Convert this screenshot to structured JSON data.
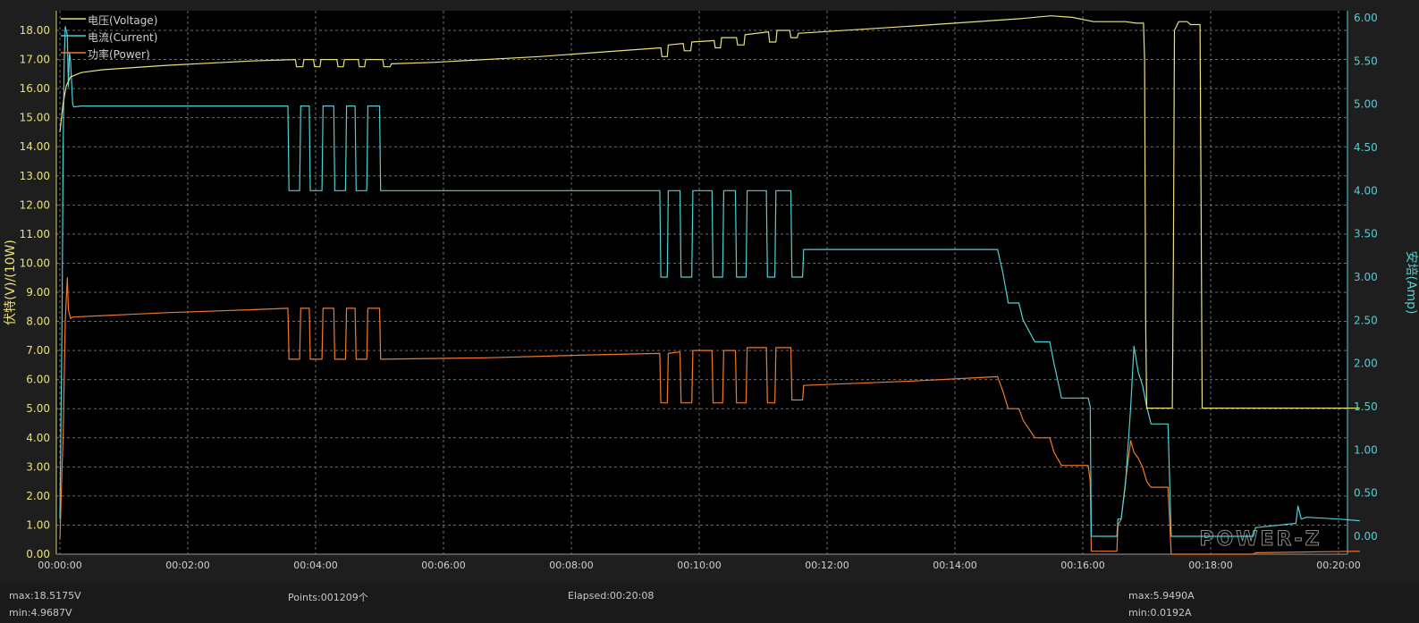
{
  "chart_data": {
    "type": "line",
    "xlabel": "",
    "y_left_label": "伏特(V)/(10W)",
    "y_right_label": "安培(Amp)",
    "x_range_seconds": [
      0,
      1220
    ],
    "x_ticks": [
      "00:00:00",
      "00:02:00",
      "00:04:00",
      "00:06:00",
      "00:08:00",
      "00:10:00",
      "00:12:00",
      "00:14:00",
      "00:16:00",
      "00:18:00",
      "00:20:00"
    ],
    "y_left_range": [
      0,
      18.5
    ],
    "y_left_ticks": [
      "0.00",
      "1.00",
      "2.00",
      "3.00",
      "4.00",
      "5.00",
      "6.00",
      "7.00",
      "8.00",
      "9.00",
      "10.00",
      "11.00",
      "12.00",
      "13.00",
      "14.00",
      "15.00",
      "16.00",
      "17.00",
      "18.00"
    ],
    "y_right_range": [
      -0.1,
      6.1
    ],
    "y_right_ticks": [
      "0.00",
      "0.50",
      "1.00",
      "1.50",
      "2.00",
      "2.50",
      "3.00",
      "3.50",
      "4.00",
      "4.50",
      "5.00",
      "5.50",
      "6.00"
    ],
    "grid": true,
    "legend_position": "top-left",
    "watermark": "POWER-Z",
    "series": [
      {
        "name": "电压(Voltage)",
        "color": "#e8e27a",
        "axis": "left",
        "points": [
          [
            0,
            14.5
          ],
          [
            3,
            15.5
          ],
          [
            6,
            16.1
          ],
          [
            10,
            16.4
          ],
          [
            20,
            16.55
          ],
          [
            40,
            16.65
          ],
          [
            100,
            16.8
          ],
          [
            180,
            16.95
          ],
          [
            221,
            17.0
          ],
          [
            222,
            16.75
          ],
          [
            228,
            16.75
          ],
          [
            229,
            17.0
          ],
          [
            238,
            17.0
          ],
          [
            239,
            16.75
          ],
          [
            244,
            16.75
          ],
          [
            245,
            17.0
          ],
          [
            260,
            17.0
          ],
          [
            261,
            16.75
          ],
          [
            266,
            16.75
          ],
          [
            267,
            17.0
          ],
          [
            280,
            17.0
          ],
          [
            281,
            16.75
          ],
          [
            286,
            16.75
          ],
          [
            287,
            17.0
          ],
          [
            303,
            17.0
          ],
          [
            304,
            16.75
          ],
          [
            310,
            16.75
          ],
          [
            311,
            16.85
          ],
          [
            350,
            16.9
          ],
          [
            450,
            17.1
          ],
          [
            564,
            17.4
          ],
          [
            565,
            17.1
          ],
          [
            570,
            17.1
          ],
          [
            571,
            17.5
          ],
          [
            585,
            17.55
          ],
          [
            586,
            17.3
          ],
          [
            592,
            17.3
          ],
          [
            593,
            17.6
          ],
          [
            614,
            17.65
          ],
          [
            615,
            17.4
          ],
          [
            620,
            17.4
          ],
          [
            621,
            17.75
          ],
          [
            635,
            17.75
          ],
          [
            636,
            17.5
          ],
          [
            642,
            17.5
          ],
          [
            643,
            17.85
          ],
          [
            665,
            17.95
          ],
          [
            666,
            17.6
          ],
          [
            672,
            17.6
          ],
          [
            673,
            18.0
          ],
          [
            685,
            18.0
          ],
          [
            686,
            17.75
          ],
          [
            692,
            17.75
          ],
          [
            693,
            17.9
          ],
          [
            800,
            18.15
          ],
          [
            900,
            18.4
          ],
          [
            930,
            18.5
          ],
          [
            950,
            18.45
          ],
          [
            970,
            18.3
          ],
          [
            1000,
            18.3
          ],
          [
            1010,
            18.25
          ],
          [
            1017,
            18.25
          ],
          [
            1018,
            17.0
          ],
          [
            1019,
            8.0
          ],
          [
            1020,
            5.02
          ],
          [
            1044,
            5.02
          ],
          [
            1045,
            10.0
          ],
          [
            1046,
            18.0
          ],
          [
            1050,
            18.3
          ],
          [
            1058,
            18.3
          ],
          [
            1061,
            18.2
          ],
          [
            1070,
            18.2
          ],
          [
            1071,
            12.0
          ],
          [
            1072,
            5.02
          ],
          [
            1220,
            5.02
          ]
        ]
      },
      {
        "name": "电流(Current)",
        "color": "#4ed0d4",
        "axis": "right",
        "points": [
          [
            0,
            0.2
          ],
          [
            2,
            2.5
          ],
          [
            3,
            4.5
          ],
          [
            4,
            5.5
          ],
          [
            5,
            5.9
          ],
          [
            7,
            5.8
          ],
          [
            8,
            5.2
          ],
          [
            9,
            5.6
          ],
          [
            10,
            5.5
          ],
          [
            12,
            5.0
          ],
          [
            13,
            4.97
          ],
          [
            20,
            4.98
          ],
          [
            100,
            4.98
          ],
          [
            180,
            4.98
          ],
          [
            214,
            4.98
          ],
          [
            215,
            4.0
          ],
          [
            225,
            4.0
          ],
          [
            226,
            4.98
          ],
          [
            234,
            4.98
          ],
          [
            235,
            4.0
          ],
          [
            246,
            4.0
          ],
          [
            247,
            4.98
          ],
          [
            257,
            4.98
          ],
          [
            258,
            4.0
          ],
          [
            268,
            4.0
          ],
          [
            269,
            4.98
          ],
          [
            277,
            4.98
          ],
          [
            278,
            4.0
          ],
          [
            288,
            4.0
          ],
          [
            289,
            4.98
          ],
          [
            300,
            4.98
          ],
          [
            301,
            4.0
          ],
          [
            303,
            4.0
          ],
          [
            304,
            4.0
          ],
          [
            400,
            4.0
          ],
          [
            500,
            4.0
          ],
          [
            563,
            4.0
          ],
          [
            564,
            3.0
          ],
          [
            570,
            3.0
          ],
          [
            571,
            4.0
          ],
          [
            582,
            4.0
          ],
          [
            583,
            3.0
          ],
          [
            593,
            3.0
          ],
          [
            594,
            4.0
          ],
          [
            612,
            4.0
          ],
          [
            613,
            3.0
          ],
          [
            622,
            3.0
          ],
          [
            623,
            4.0
          ],
          [
            634,
            4.0
          ],
          [
            635,
            3.0
          ],
          [
            644,
            3.0
          ],
          [
            645,
            4.0
          ],
          [
            663,
            4.0
          ],
          [
            664,
            3.0
          ],
          [
            671,
            3.0
          ],
          [
            672,
            4.0
          ],
          [
            686,
            4.0
          ],
          [
            687,
            3.0
          ],
          [
            697,
            3.0
          ],
          [
            698,
            3.32
          ],
          [
            800,
            3.32
          ],
          [
            880,
            3.32
          ],
          [
            885,
            3.05
          ],
          [
            890,
            2.7
          ],
          [
            900,
            2.7
          ],
          [
            904,
            2.5
          ],
          [
            915,
            2.25
          ],
          [
            929,
            2.25
          ],
          [
            933,
            2.0
          ],
          [
            940,
            1.6
          ],
          [
            965,
            1.6
          ],
          [
            967,
            1.5
          ],
          [
            968,
            0.0
          ],
          [
            992,
            0.0
          ],
          [
            993,
            0.2
          ],
          [
            996,
            0.2
          ],
          [
            1000,
            0.6
          ],
          [
            1005,
            1.5
          ],
          [
            1008,
            2.2
          ],
          [
            1012,
            1.9
          ],
          [
            1016,
            1.75
          ],
          [
            1020,
            1.5
          ],
          [
            1024,
            1.3
          ],
          [
            1040,
            1.3
          ],
          [
            1043,
            0.0
          ],
          [
            1070,
            0.0
          ],
          [
            1120,
            0.0
          ],
          [
            1122,
            0.1
          ],
          [
            1160,
            0.15
          ],
          [
            1162,
            0.35
          ],
          [
            1165,
            0.2
          ],
          [
            1170,
            0.22
          ],
          [
            1200,
            0.2
          ],
          [
            1220,
            0.18
          ]
        ]
      },
      {
        "name": "功率(Power)",
        "color": "#ee7b2c",
        "axis": "left",
        "points": [
          [
            0,
            0.5
          ],
          [
            2,
            3.0
          ],
          [
            3,
            4.0
          ],
          [
            5,
            8.0
          ],
          [
            7,
            9.5
          ],
          [
            8,
            8.4
          ],
          [
            10,
            8.1
          ],
          [
            12,
            8.15
          ],
          [
            100,
            8.3
          ],
          [
            180,
            8.4
          ],
          [
            214,
            8.45
          ],
          [
            215,
            6.7
          ],
          [
            225,
            6.7
          ],
          [
            226,
            8.45
          ],
          [
            234,
            8.45
          ],
          [
            235,
            6.7
          ],
          [
            246,
            6.7
          ],
          [
            247,
            8.45
          ],
          [
            257,
            8.45
          ],
          [
            258,
            6.7
          ],
          [
            268,
            6.7
          ],
          [
            269,
            8.45
          ],
          [
            277,
            8.45
          ],
          [
            278,
            6.7
          ],
          [
            288,
            6.7
          ],
          [
            289,
            8.45
          ],
          [
            300,
            8.45
          ],
          [
            301,
            6.7
          ],
          [
            400,
            6.75
          ],
          [
            500,
            6.85
          ],
          [
            563,
            6.9
          ],
          [
            564,
            5.2
          ],
          [
            570,
            5.2
          ],
          [
            571,
            6.9
          ],
          [
            582,
            6.95
          ],
          [
            583,
            5.2
          ],
          [
            593,
            5.2
          ],
          [
            594,
            7.0
          ],
          [
            612,
            7.0
          ],
          [
            613,
            5.2
          ],
          [
            622,
            5.2
          ],
          [
            623,
            7.0
          ],
          [
            634,
            7.0
          ],
          [
            635,
            5.2
          ],
          [
            644,
            5.2
          ],
          [
            645,
            7.1
          ],
          [
            663,
            7.1
          ],
          [
            664,
            5.2
          ],
          [
            671,
            5.2
          ],
          [
            672,
            7.1
          ],
          [
            686,
            7.1
          ],
          [
            687,
            5.3
          ],
          [
            697,
            5.3
          ],
          [
            698,
            5.8
          ],
          [
            800,
            5.95
          ],
          [
            880,
            6.1
          ],
          [
            885,
            5.6
          ],
          [
            890,
            5.0
          ],
          [
            900,
            5.0
          ],
          [
            904,
            4.6
          ],
          [
            915,
            4.0
          ],
          [
            929,
            4.0
          ],
          [
            933,
            3.5
          ],
          [
            940,
            3.05
          ],
          [
            965,
            3.05
          ],
          [
            967,
            2.5
          ],
          [
            968,
            0.1
          ],
          [
            992,
            0.1
          ],
          [
            993,
            1.0
          ],
          [
            996,
            1.2
          ],
          [
            1000,
            2.5
          ],
          [
            1005,
            3.9
          ],
          [
            1008,
            3.5
          ],
          [
            1012,
            3.3
          ],
          [
            1016,
            3.0
          ],
          [
            1020,
            2.5
          ],
          [
            1024,
            2.3
          ],
          [
            1040,
            2.3
          ],
          [
            1043,
            0.0
          ],
          [
            1120,
            0.0
          ],
          [
            1122,
            0.05
          ],
          [
            1220,
            0.1
          ]
        ]
      }
    ]
  },
  "status": {
    "v_max": "max:18.5175V",
    "v_min": "min:4.9687V",
    "points": "Points:001209个",
    "elapsed": "Elapsed:00:20:08",
    "a_max": "max:5.9490A",
    "a_min": "min:0.0192A"
  }
}
